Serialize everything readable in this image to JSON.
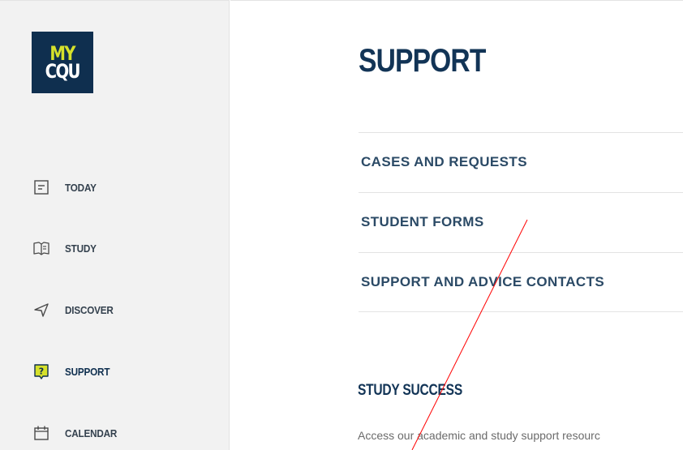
{
  "brand": {
    "logo_line1": "MY",
    "logo_line2": "CQU"
  },
  "sidebar": {
    "items": [
      {
        "label": "TODAY",
        "icon": "today-icon"
      },
      {
        "label": "STUDY",
        "icon": "book-icon"
      },
      {
        "label": "DISCOVER",
        "icon": "navigation-icon"
      },
      {
        "label": "SUPPORT",
        "icon": "help-icon",
        "active": true
      },
      {
        "label": "CALENDAR",
        "icon": "calendar-icon"
      }
    ]
  },
  "main": {
    "title": "SUPPORT",
    "menu": [
      {
        "label": "CASES AND REQUESTS"
      },
      {
        "label": "STUDENT FORMS"
      },
      {
        "label": "SUPPORT AND ADVICE CONTACTS"
      }
    ],
    "section": {
      "title": "STUDY SUCCESS",
      "description": "Access our academic and study support resourc"
    }
  },
  "colors": {
    "brand_navy": "#0f2f4f",
    "brand_lime": "#d6e12b",
    "menu_text": "#2b4a66",
    "annotation_line": "#ff0000"
  }
}
